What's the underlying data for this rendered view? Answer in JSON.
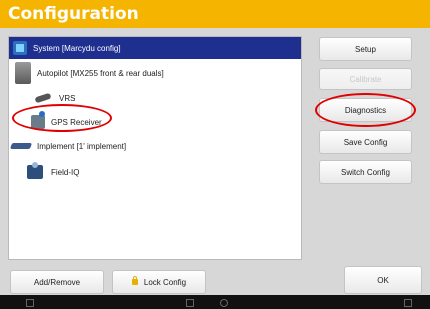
{
  "window": {
    "title": "Configuration"
  },
  "devices": [
    {
      "label": "System [Marcydu config]",
      "icon": "system-icon",
      "selected": true
    },
    {
      "label": "Autopilot [MX255 front & rear duals]",
      "icon": "autopilot-icon",
      "selected": false
    },
    {
      "label": "VRS",
      "icon": "vrs-icon",
      "selected": false
    },
    {
      "label": "GPS Receiver",
      "icon": "gps-receiver-icon",
      "selected": false
    },
    {
      "label": "Implement [1' implement]",
      "icon": "implement-icon",
      "selected": false
    },
    {
      "label": "Field-IQ",
      "icon": "field-iq-icon",
      "selected": false
    }
  ],
  "actions": {
    "setup": "Setup",
    "calibrate": "Calibrate",
    "diagnostics": "Diagnostics",
    "save_config": "Save Config",
    "switch_config": "Switch Config",
    "ok": "OK"
  },
  "bottom": {
    "add_remove": "Add/Remove",
    "lock_config": "Lock Config"
  },
  "colors": {
    "title_bar": "#f4b400",
    "selected_row": "#1f2f8f",
    "callout": "#e00000"
  }
}
